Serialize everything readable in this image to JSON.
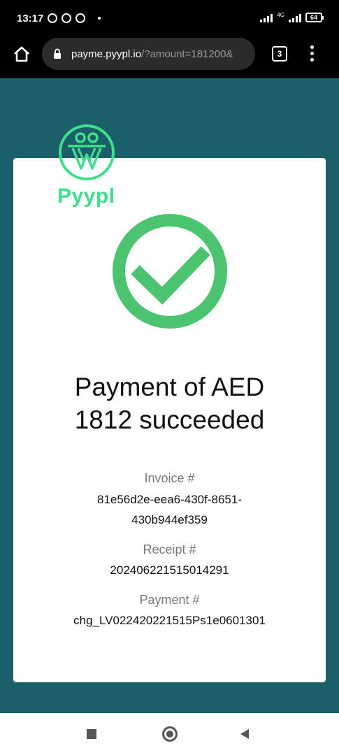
{
  "status_bar": {
    "time": "13:17",
    "network_label": "4G",
    "battery": "64"
  },
  "browser": {
    "url_host": "payme.pyypl.io",
    "url_path": "/?amount=181200&",
    "tab_count": "3"
  },
  "brand": {
    "name": "Pyypl",
    "accent_color": "#3ee08b"
  },
  "payment": {
    "title_line1": "Payment of AED",
    "title_line2": "1812 succeeded",
    "invoice_label": "Invoice #",
    "invoice_line1": "81e56d2e-eea6-430f-8651-",
    "invoice_line2": "430b944ef359",
    "receipt_label": "Receipt #",
    "receipt_value": "202406221515014291",
    "payment_label": "Payment #",
    "payment_value": "chg_LV022420221515Ps1e0601301",
    "success_color": "#4cc36e"
  },
  "icons": {
    "home": "home-icon",
    "lock": "lock-icon",
    "menu": "more-vert-icon",
    "success": "check-circle-icon",
    "nav_recent": "recent-apps-icon",
    "nav_home": "home-circle-icon",
    "nav_back": "back-icon"
  }
}
